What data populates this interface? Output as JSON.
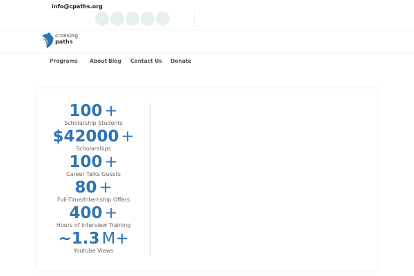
{
  "header": {
    "email": "info@cpaths.org",
    "social_icons": [
      "facebook-icon",
      "twitter-icon",
      "instagram-icon",
      "linkedin-icon",
      "youtube-icon"
    ]
  },
  "logo": {
    "line1": "crossing",
    "line2": "paths"
  },
  "nav": {
    "items": [
      "Programs",
      "About",
      "Blog",
      "Contact Us",
      "Donate"
    ]
  },
  "stats": [
    {
      "prefix": "",
      "value": "100",
      "suffix": "+",
      "label": "Scholarship Students"
    },
    {
      "prefix": "$",
      "value": "42000",
      "suffix": "+",
      "label": "Scholarships"
    },
    {
      "prefix": "",
      "value": "100",
      "suffix": "+",
      "label": "Career Talks Guests"
    },
    {
      "prefix": "",
      "value": "80",
      "suffix": "+",
      "label": "Full-Time/Internship Offers"
    },
    {
      "prefix": "",
      "value": "400",
      "suffix": "+",
      "label": "Hours of Interview Training"
    },
    {
      "prefix": "~",
      "value": "1.3",
      "suffix": "M+",
      "label": "Youtube Views"
    }
  ],
  "colors": {
    "accent": "#2e74b0",
    "social_bg": "#e6eeee"
  }
}
